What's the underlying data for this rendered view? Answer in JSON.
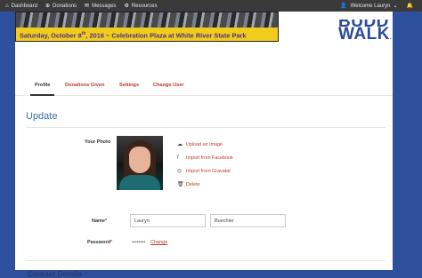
{
  "nav": {
    "items": [
      {
        "label": "Dashboard",
        "icon": "dashboard-icon",
        "glyph": "⌂"
      },
      {
        "label": "Donations",
        "icon": "donations-icon",
        "glyph": "⊕"
      },
      {
        "label": "Messages",
        "icon": "messages-icon",
        "glyph": "✉"
      },
      {
        "label": "Resources",
        "icon": "resources-icon",
        "glyph": "⚙"
      }
    ],
    "welcome": "Welcome Lauryn"
  },
  "banner": {
    "text_pre": "Saturday, October 8",
    "text_sup": "th",
    "text_post": ", 2016 ~ Celebration Plaza at White River State Park"
  },
  "logo": {
    "line1": "BUDDY",
    "line2": "WALK",
    "suffix": "."
  },
  "tabs": [
    {
      "label": "Profile",
      "active": true
    },
    {
      "label": "Donations Given"
    },
    {
      "label": "Settings"
    },
    {
      "label": "Change User"
    }
  ],
  "page_title": "Update",
  "photo": {
    "label": "Your Photo",
    "actions": [
      {
        "label": "Upload an Image",
        "icon": "cloud-upload-icon",
        "glyph": "☁"
      },
      {
        "label": "Import from Facebook",
        "icon": "facebook-icon",
        "glyph": "f"
      },
      {
        "label": "Import from Gravatar",
        "icon": "gravatar-icon",
        "glyph": "◎"
      },
      {
        "label": "Delete",
        "icon": "trash-icon",
        "glyph": "🗑"
      }
    ]
  },
  "form": {
    "name_label": "Name",
    "first_name": "Lauryn",
    "last_name": "Buechler",
    "password_label": "Password",
    "password_mask": "••••••••",
    "password_change": "Change",
    "required_mark": "*"
  },
  "section_contact": "Contact Details",
  "colors": {
    "accent": "#c0392b",
    "heading": "#3a6db0",
    "nav_bg": "#3a3a3a",
    "page_bg": "#2e4f9c"
  }
}
